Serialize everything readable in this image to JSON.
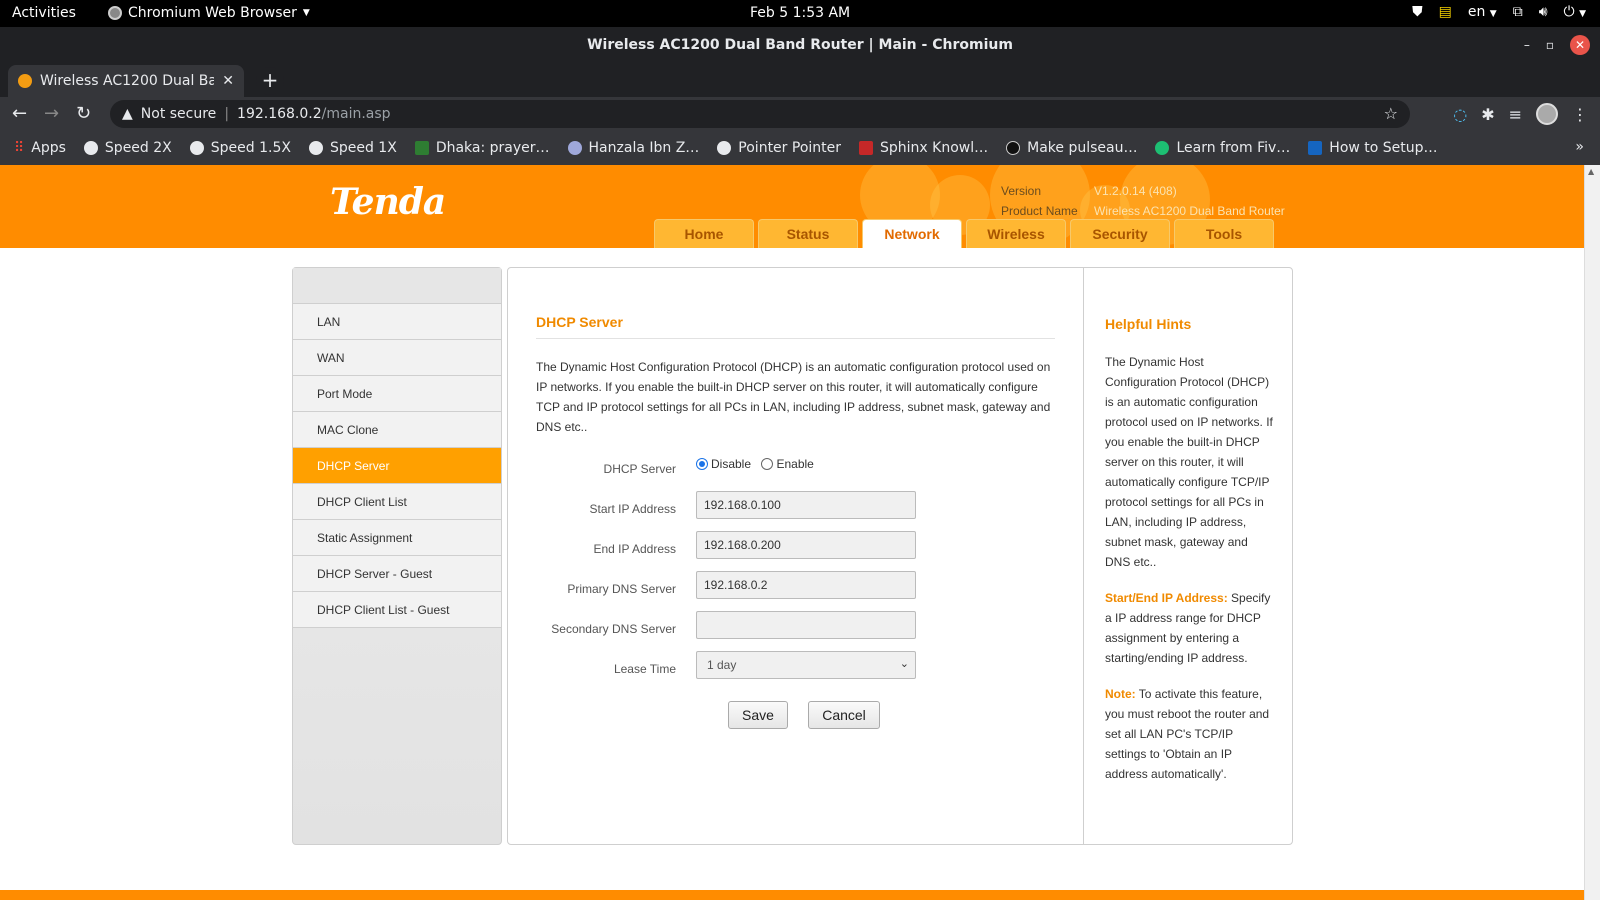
{
  "system": {
    "activities": "Activities",
    "app_name": "Chromium Web Browser",
    "clock": "Feb 5  1:53 AM",
    "lang": "en"
  },
  "window": {
    "title": "Wireless AC1200 Dual Band Router | Main - Chromium"
  },
  "tab": {
    "title": "Wireless AC1200 Dual Band Router"
  },
  "omnibox": {
    "security": "Not secure",
    "host": "192.168.0.2",
    "path": "/main.asp"
  },
  "bookmarks": [
    "Apps",
    "Speed 2X",
    "Speed 1.5X",
    "Speed 1X",
    "Dhaka: prayer…",
    "Hanzala Ibn Z…",
    "Pointer Pointer",
    "Sphinx Knowl…",
    "Make pulseau…",
    "Learn from Fiv…",
    "How to Setup…"
  ],
  "router": {
    "logo": "Tenda",
    "version_label": "Version",
    "version_value": "V1.2.0.14 (408)",
    "product_label": "Product Name",
    "product_value": "Wireless AC1200 Dual Band Router",
    "nav": [
      "Home",
      "Status",
      "Network",
      "Wireless",
      "Security",
      "Tools"
    ],
    "nav_active": "Network",
    "sidebar": [
      "LAN",
      "WAN",
      "Port Mode",
      "MAC Clone",
      "DHCP Server",
      "DHCP Client List",
      "Static Assignment",
      "DHCP Server - Guest",
      "DHCP Client List - Guest"
    ],
    "sidebar_active": "DHCP Server"
  },
  "main": {
    "title": "DHCP Server",
    "description": "The Dynamic Host Configuration Protocol (DHCP) is an automatic configuration protocol used on IP networks. If you enable the built-in DHCP server on this router, it will automatically configure TCP and IP protocol settings for all PCs in LAN, including IP address, subnet mask, gateway and DNS etc..",
    "dhcp_label": "DHCP Server",
    "disable_label": "Disable",
    "enable_label": "Enable",
    "start_ip_label": "Start IP Address",
    "start_ip_value": "192.168.0.100",
    "end_ip_label": "End IP Address",
    "end_ip_value": "192.168.0.200",
    "primary_dns_label": "Primary DNS Server",
    "primary_dns_value": "192.168.0.2",
    "secondary_dns_label": "Secondary DNS Server",
    "secondary_dns_value": "",
    "lease_label": "Lease Time",
    "lease_value": "1 day",
    "save": "Save",
    "cancel": "Cancel"
  },
  "hints": {
    "title": "Helpful Hints",
    "p1": "The Dynamic Host Configuration Protocol (DHCP) is an automatic configuration protocol used on IP networks. If you enable the built-in DHCP server on this router, it will automatically configure TCP/IP protocol settings for all PCs in LAN, including IP address, subnet mask, gateway and DNS etc..",
    "p2_key": "Start/End IP Address:",
    "p2_text": " Specify a IP address range for DHCP assignment by entering a starting/ending IP address.",
    "p3_key": "Note:",
    "p3_text": " To activate this feature, you must reboot the router and set all LAN PC's TCP/IP settings to 'Obtain an IP address automatically'."
  }
}
